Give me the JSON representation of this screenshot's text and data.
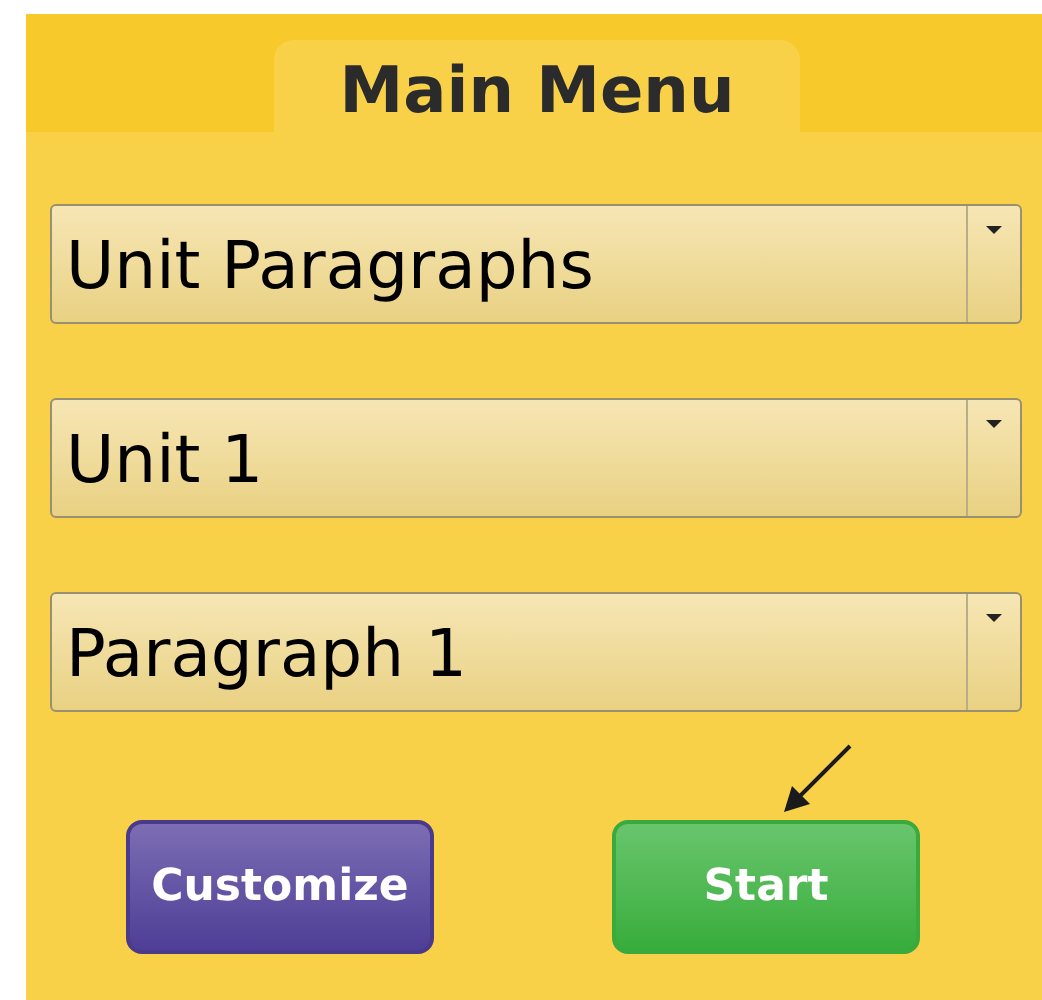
{
  "title": "Main Menu",
  "dropdowns": [
    {
      "value": "Unit Paragraphs"
    },
    {
      "value": "Unit 1"
    },
    {
      "value": "Paragraph 1"
    }
  ],
  "buttons": [
    {
      "label": "Customize",
      "kind": "secondary"
    },
    {
      "label": "Start",
      "kind": "primary"
    }
  ]
}
